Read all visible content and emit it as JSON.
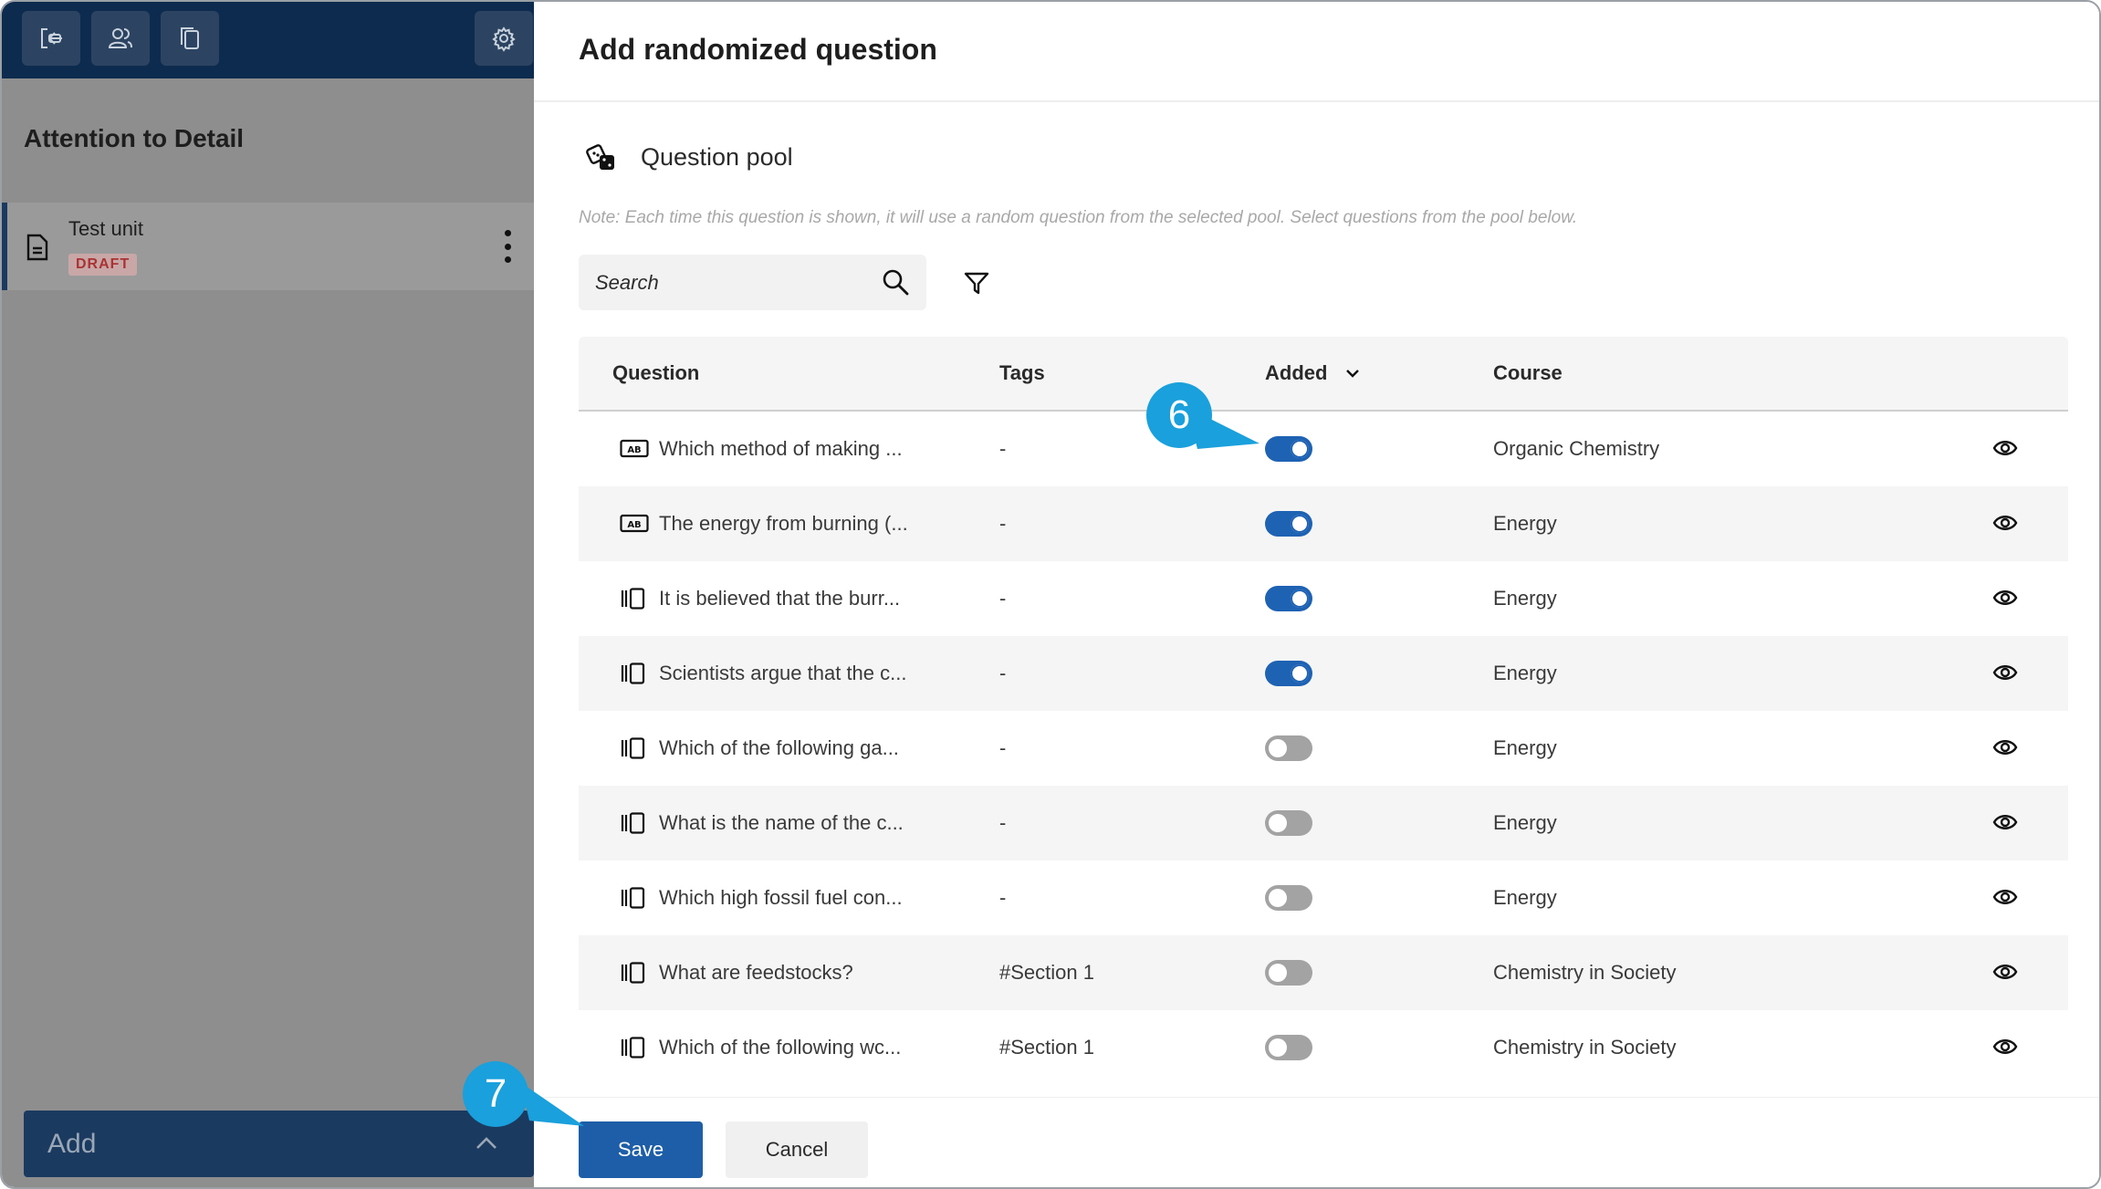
{
  "sidebar": {
    "toolbar": [
      {
        "name": "exit-icon"
      },
      {
        "name": "users-icon"
      },
      {
        "name": "copy-icon"
      }
    ],
    "settings_icon": "gear-icon",
    "course_title": "Attention to Detail",
    "unit": {
      "name": "Test unit",
      "badge": "DRAFT"
    },
    "add_label": "Add"
  },
  "modal": {
    "title": "Add randomized question",
    "pool_label": "Question pool",
    "note": "Note: Each time this question is shown, it will use a random question from the selected pool. Select questions from the pool below.",
    "search": {
      "placeholder": "Search"
    },
    "table": {
      "headers": {
        "question": "Question",
        "tags": "Tags",
        "added": "Added",
        "course": "Course"
      },
      "rows": [
        {
          "icon": "ab-icon",
          "question": "Which method of making ...",
          "tags": "-",
          "added": true,
          "course": "Organic Chemistry"
        },
        {
          "icon": "ab-icon",
          "question": "The energy from burning (...",
          "tags": "-",
          "added": true,
          "course": "Energy"
        },
        {
          "icon": "order-icon",
          "question": "It is believed that the burr...",
          "tags": "-",
          "added": true,
          "course": "Energy"
        },
        {
          "icon": "order-icon",
          "question": "Scientists argue that the c...",
          "tags": "-",
          "added": true,
          "course": "Energy"
        },
        {
          "icon": "order-icon",
          "question": "Which of the following ga...",
          "tags": "-",
          "added": false,
          "course": "Energy"
        },
        {
          "icon": "order-icon",
          "question": "What is the name of the c...",
          "tags": "-",
          "added": false,
          "course": "Energy"
        },
        {
          "icon": "order-icon",
          "question": "Which high fossil fuel con...",
          "tags": "-",
          "added": false,
          "course": "Energy"
        },
        {
          "icon": "order-icon",
          "question": "What are feedstocks?",
          "tags": "#Section 1",
          "added": false,
          "course": "Chemistry in Society"
        },
        {
          "icon": "order-icon",
          "question": "Which of the following wc...",
          "tags": "#Section 1",
          "added": false,
          "course": "Chemistry in Society"
        }
      ]
    },
    "save_label": "Save",
    "cancel_label": "Cancel"
  },
  "callouts": {
    "step_toggle": "6",
    "step_save": "7"
  },
  "colors": {
    "accent": "#1e62b3",
    "callout": "#1aa0dc",
    "sidebar_header": "#0d2b4e"
  }
}
